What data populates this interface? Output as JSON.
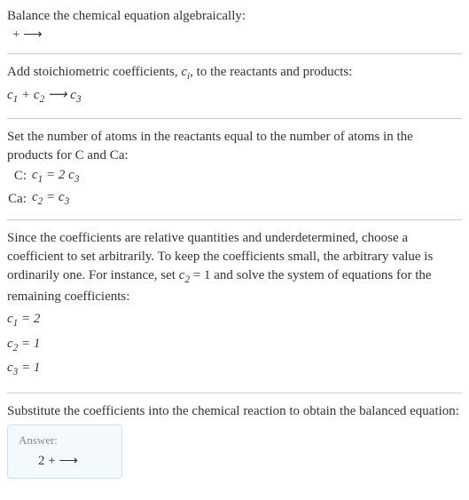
{
  "intro": {
    "line1": "Balance the chemical equation algebraically:",
    "reaction": " +  ⟶ "
  },
  "addcoef": {
    "text": "Add stoichiometric coefficients, ",
    "ci": "c",
    "cisub": "i",
    "text2": ", to the reactants and products:",
    "eq_c1": "c",
    "eq_c1sub": "1",
    "eq_plus": " + ",
    "eq_c2": "c",
    "eq_c2sub": "2",
    "eq_arrow": "  ⟶ ",
    "eq_c3": "c",
    "eq_c3sub": "3"
  },
  "atoms": {
    "text": "Set the number of atoms in the reactants equal to the number of atoms in the products for C and Ca:",
    "row1_label": "C:",
    "row1_lhs_c": "c",
    "row1_lhs_sub": "1",
    "row1_eq": " = 2 ",
    "row1_rhs_c": "c",
    "row1_rhs_sub": "3",
    "row2_label": "Ca:",
    "row2_lhs_c": "c",
    "row2_lhs_sub": "2",
    "row2_eq": " = ",
    "row2_rhs_c": "c",
    "row2_rhs_sub": "3"
  },
  "solve": {
    "text1": "Since the coefficients are relative quantities and underdetermined, choose a coefficient to set arbitrarily. To keep the coefficients small, the arbitrary value is ordinarily one. For instance, set ",
    "cvar": "c",
    "csub": "2",
    "text2": " = 1 and solve the system of equations for the remaining coefficients:",
    "r1_c": "c",
    "r1_sub": "1",
    "r1_val": " = 2",
    "r2_c": "c",
    "r2_sub": "2",
    "r2_val": " = 1",
    "r3_c": "c",
    "r3_sub": "3",
    "r3_val": " = 1"
  },
  "subst": {
    "text": "Substitute the coefficients into the chemical reaction to obtain the balanced equation:"
  },
  "answer": {
    "label": "Answer:",
    "eq": "2  +  ⟶ "
  }
}
